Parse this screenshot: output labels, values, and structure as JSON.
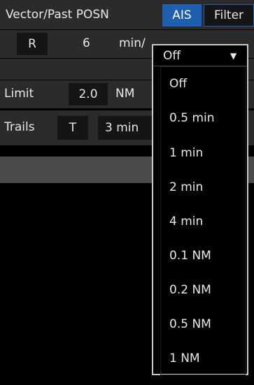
{
  "row1": {
    "title": "Vector/Past POSN",
    "ais_tab": "AIS",
    "filter_tab": "Filter"
  },
  "row2": {
    "r_button": "R",
    "value": "6",
    "unit": "min/"
  },
  "row3": {
    "label": "Limit",
    "value": "2.0",
    "unit": "NM"
  },
  "row4": {
    "label": "Trails",
    "t_button": "T",
    "value": "3 min"
  },
  "dropdown": {
    "selected": "Off",
    "options": [
      "Off",
      "0.5 min",
      "1 min",
      "2 min",
      "4 min",
      "0.1 NM",
      "0.2 NM",
      "0.5 NM",
      "1 NM"
    ]
  },
  "colors": {
    "accent": "#1f5fb0",
    "panel": "#2b2b2b",
    "background": "#000000"
  }
}
